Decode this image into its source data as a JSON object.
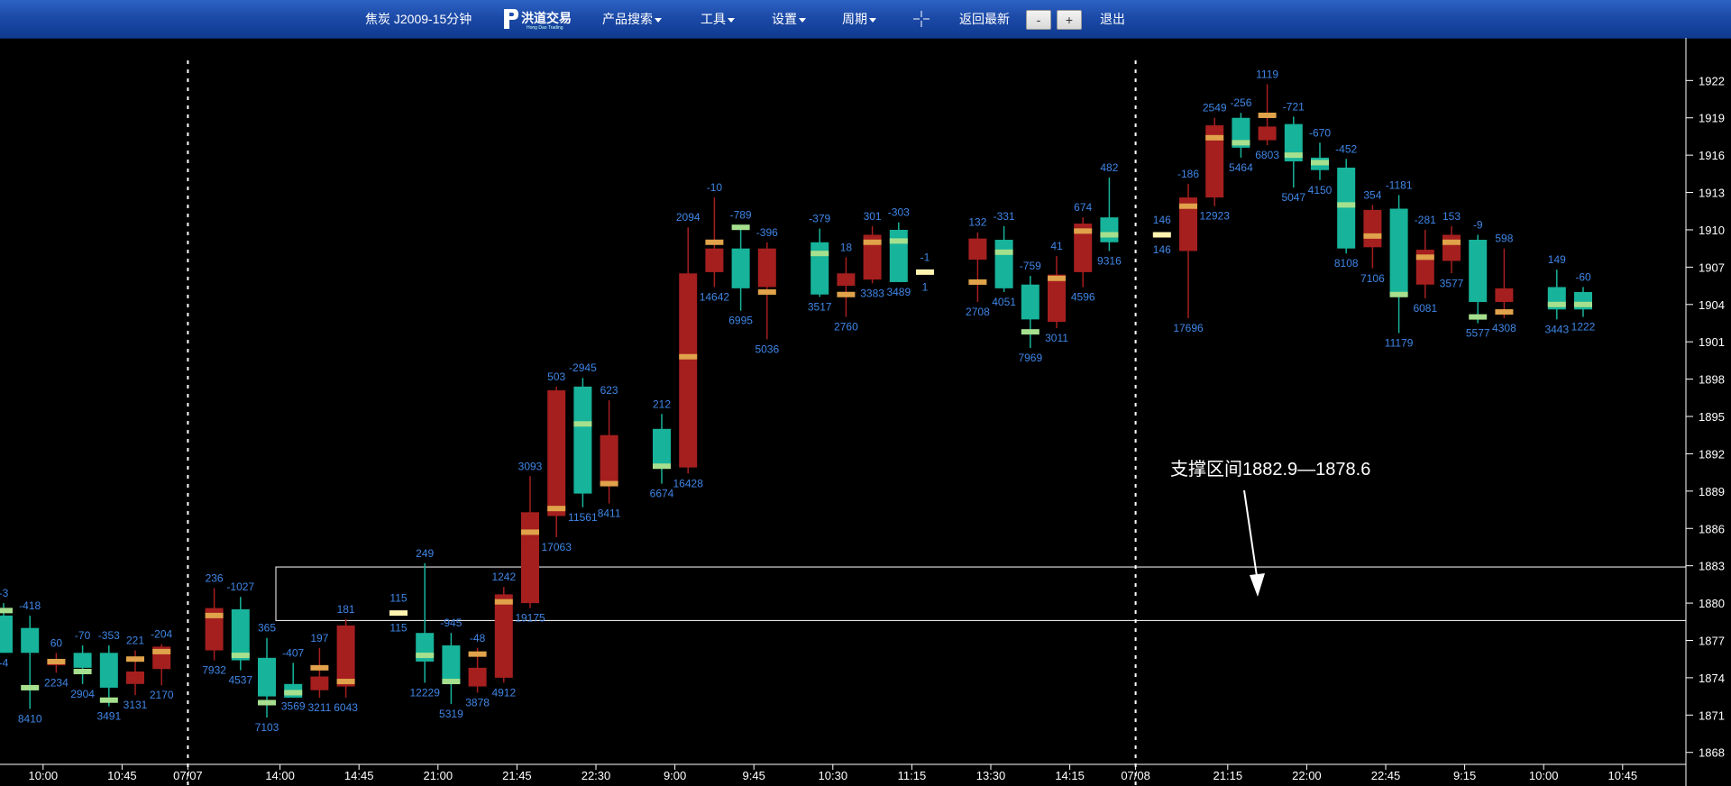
{
  "toolbar": {
    "symbol_title": "焦炭 J2009-15分钟",
    "logo_text": "洪道交易",
    "logo_subtext": "Hong Dao Trading",
    "menu_product_search": "产品搜索",
    "menu_tools": "工具",
    "menu_settings": "设置",
    "menu_period": "周期",
    "crosshair_icon": "crosshair-icon",
    "back_to_latest": "返回最新",
    "zoom_out": "-",
    "zoom_in": "+",
    "exit": "退出"
  },
  "annotation": {
    "text": "支撑区间1882.9—1878.6"
  },
  "colors": {
    "up": "#a51f1f",
    "down": "#17b39b",
    "vwap_up": "#e0a24a",
    "vwap_down": "#a6e08e",
    "label": "#3f86e6",
    "axis": "#ffffff"
  },
  "chart_data": {
    "type": "candlestick",
    "title": "焦炭 J2009-15分钟",
    "ylim": [
      1867.4,
      1923.4
    ],
    "y_ticks": [
      1868,
      1871,
      1874,
      1877,
      1880,
      1883,
      1886,
      1889,
      1892,
      1895,
      1898,
      1901,
      1904,
      1907,
      1910,
      1913,
      1916,
      1919,
      1922
    ],
    "x_ticks": [
      {
        "i": 1.5,
        "label": "10:00"
      },
      {
        "i": 4.5,
        "label": "10:45"
      },
      {
        "i": 7.0,
        "label": "07/07"
      },
      {
        "i": 10.5,
        "label": "14:00"
      },
      {
        "i": 13.5,
        "label": "14:45"
      },
      {
        "i": 16.5,
        "label": "21:00"
      },
      {
        "i": 19.5,
        "label": "21:45"
      },
      {
        "i": 22.5,
        "label": "22:30"
      },
      {
        "i": 25.5,
        "label": "9:00"
      },
      {
        "i": 28.5,
        "label": "9:45"
      },
      {
        "i": 31.5,
        "label": "10:30"
      },
      {
        "i": 34.5,
        "label": "11:15"
      },
      {
        "i": 37.5,
        "label": "13:30"
      },
      {
        "i": 40.5,
        "label": "14:15"
      },
      {
        "i": 43.0,
        "label": "07/08"
      },
      {
        "i": 46.5,
        "label": "21:15"
      },
      {
        "i": 49.5,
        "label": "22:00"
      },
      {
        "i": 52.5,
        "label": "22:45"
      },
      {
        "i": 55.5,
        "label": "9:15"
      },
      {
        "i": 58.5,
        "label": "10:00"
      },
      {
        "i": 61.5,
        "label": "10:45"
      }
    ],
    "session_dividers": [
      7.0,
      43.0
    ],
    "support_zone": [
      1878.6,
      1882.9
    ],
    "candles": [
      {
        "i": 0,
        "o": 1879,
        "h": 1880,
        "l": 1876,
        "c": 1876,
        "vw": 1879.4,
        "top": "-3",
        "bot": "-4"
      },
      {
        "i": 1,
        "o": 1878,
        "h": 1879,
        "l": 1871.5,
        "c": 1876,
        "vw": 1873.2,
        "top": "-418",
        "bot": "8410"
      },
      {
        "i": 2,
        "o": 1875,
        "h": 1876,
        "l": 1874.4,
        "c": 1875.5,
        "vw": 1875.3,
        "top": "60",
        "bot": "2234"
      },
      {
        "i": 3,
        "o": 1876,
        "h": 1876.6,
        "l": 1873.5,
        "c": 1874.8,
        "vw": 1874.5,
        "top": "-70",
        "bot": "2904"
      },
      {
        "i": 4,
        "o": 1876,
        "h": 1876.6,
        "l": 1871.7,
        "c": 1873.2,
        "vw": 1872.2,
        "top": "-353",
        "bot": "3491"
      },
      {
        "i": 5,
        "o": 1873.5,
        "h": 1876.2,
        "l": 1872.6,
        "c": 1874.5,
        "vw": 1875.5,
        "top": "221",
        "bot": "3131"
      },
      {
        "i": 6,
        "o": 1874.7,
        "h": 1876.7,
        "l": 1873.4,
        "c": 1876.5,
        "vw": 1876.1,
        "top": "-204",
        "bot": "2170"
      },
      {
        "i": 8,
        "o": 1876.2,
        "h": 1881.2,
        "l": 1875.4,
        "c": 1879.6,
        "vw": 1879.0,
        "top": "236",
        "bot": "7932"
      },
      {
        "i": 9,
        "o": 1879.5,
        "h": 1880.5,
        "l": 1874.6,
        "c": 1875.4,
        "vw": 1875.8,
        "top": "-1027",
        "bot": "4537"
      },
      {
        "i": 10,
        "o": 1875.6,
        "h": 1877.2,
        "l": 1870.8,
        "c": 1872.5,
        "vw": 1872.0,
        "top": "365",
        "bot": "7103"
      },
      {
        "i": 11,
        "o": 1873.5,
        "h": 1875.2,
        "l": 1872.5,
        "c": 1872.4,
        "vw": 1872.8,
        "top": "-407",
        "bot": "3569"
      },
      {
        "i": 12,
        "o": 1873.0,
        "h": 1876.4,
        "l": 1872.4,
        "c": 1874.1,
        "vw": 1874.8,
        "top": "197",
        "bot": "3211"
      },
      {
        "i": 13,
        "o": 1873.3,
        "h": 1878.7,
        "l": 1872.4,
        "c": 1878.2,
        "vw": 1873.7,
        "top": "181",
        "bot": "6043"
      },
      {
        "i": 15,
        "o": 1879.2,
        "h": 1879.6,
        "l": 1878.8,
        "c": 1879.2,
        "vw": 1879.2,
        "top": "115",
        "bot": "115",
        "doji": true
      },
      {
        "i": 16,
        "o": 1877.6,
        "h": 1883.2,
        "l": 1873.6,
        "c": 1875.3,
        "vw": 1875.8,
        "top": "249",
        "bot": "12229"
      },
      {
        "i": 17,
        "o": 1876.6,
        "h": 1877.6,
        "l": 1871.9,
        "c": 1873.5,
        "vw": 1873.7,
        "top": "-945",
        "bot": "5319"
      },
      {
        "i": 18,
        "o": 1873.3,
        "h": 1876.4,
        "l": 1872.8,
        "c": 1874.8,
        "vw": 1875.9,
        "top": "-48",
        "bot": "3878"
      },
      {
        "i": 19,
        "o": 1874.0,
        "h": 1881.3,
        "l": 1873.6,
        "c": 1880.7,
        "vw": 1880.1,
        "top": "1242",
        "bot": "4912"
      },
      {
        "i": 20,
        "o": 1880.0,
        "h": 1890.2,
        "l": 1879.6,
        "c": 1887.3,
        "vw": 1885.7,
        "top": "3093",
        "bot": "19175"
      },
      {
        "i": 21,
        "o": 1887.0,
        "h": 1897.4,
        "l": 1885.3,
        "c": 1897.1,
        "vw": 1887.6,
        "top": "503",
        "bot": "17063"
      },
      {
        "i": 22,
        "o": 1897.4,
        "h": 1898.1,
        "l": 1887.7,
        "c": 1888.8,
        "vw": 1894.4,
        "top": "-2945",
        "bot": "11561"
      },
      {
        "i": 23,
        "o": 1889.5,
        "h": 1896.3,
        "l": 1888.0,
        "c": 1893.5,
        "vw": 1889.6,
        "top": "623",
        "bot": "8411"
      },
      {
        "i": 25,
        "o": 1894.0,
        "h": 1895.2,
        "l": 1889.6,
        "c": 1890.9,
        "vw": 1891.0,
        "top": "212",
        "bot": "6674"
      },
      {
        "i": 26,
        "o": 1890.9,
        "h": 1910.2,
        "l": 1890.4,
        "c": 1906.5,
        "vw": 1899.8,
        "top": "2094",
        "bot": "16428"
      },
      {
        "i": 27,
        "o": 1906.6,
        "h": 1912.6,
        "l": 1905.4,
        "c": 1908.5,
        "vw": 1909.0,
        "top": "-10",
        "bot": "14642"
      },
      {
        "i": 28,
        "o": 1908.5,
        "h": 1910.4,
        "l": 1903.5,
        "c": 1905.3,
        "vw": 1910.2,
        "top": "-789",
        "bot": "6995"
      },
      {
        "i": 29,
        "o": 1905.4,
        "h": 1909.0,
        "l": 1901.2,
        "c": 1908.5,
        "vw": 1905.0,
        "top": "-396",
        "bot": "5036"
      },
      {
        "i": 31,
        "o": 1909.0,
        "h": 1910.1,
        "l": 1904.6,
        "c": 1904.8,
        "vw": 1908.1,
        "top": "-379",
        "bot": "3517"
      },
      {
        "i": 32,
        "o": 1905.5,
        "h": 1907.8,
        "l": 1903.0,
        "c": 1906.5,
        "vw": 1904.8,
        "top": "18",
        "bot": "2760"
      },
      {
        "i": 33,
        "o": 1906.0,
        "h": 1910.3,
        "l": 1905.7,
        "c": 1909.6,
        "vw": 1909.0,
        "top": "301",
        "bot": "3383"
      },
      {
        "i": 34,
        "o": 1910.0,
        "h": 1910.6,
        "l": 1905.8,
        "c": 1905.8,
        "vw": 1909.1,
        "top": "-303",
        "bot": "3489"
      },
      {
        "i": 35,
        "o": 1906.6,
        "h": 1907.0,
        "l": 1906.2,
        "c": 1906.6,
        "vw": 1906.6,
        "top": "-1",
        "bot": "1",
        "doji": true
      },
      {
        "i": 37,
        "o": 1907.6,
        "h": 1909.8,
        "l": 1904.2,
        "c": 1909.3,
        "vw": 1905.8,
        "top": "132",
        "bot": "2708"
      },
      {
        "i": 38,
        "o": 1909.2,
        "h": 1910.3,
        "l": 1905.0,
        "c": 1905.3,
        "vw": 1908.2,
        "top": "-331",
        "bot": "4051"
      },
      {
        "i": 39,
        "o": 1905.6,
        "h": 1906.3,
        "l": 1900.5,
        "c": 1902.8,
        "vw": 1901.8,
        "top": "-759",
        "bot": "7969"
      },
      {
        "i": 40,
        "o": 1902.6,
        "h": 1907.9,
        "l": 1902.1,
        "c": 1906.4,
        "vw": 1906.1,
        "top": "41",
        "bot": "3011"
      },
      {
        "i": 41,
        "o": 1906.6,
        "h": 1911.0,
        "l": 1905.4,
        "c": 1910.5,
        "vw": 1909.9,
        "top": "674",
        "bot": "4596"
      },
      {
        "i": 42,
        "o": 1911.0,
        "h": 1914.2,
        "l": 1908.3,
        "c": 1909.0,
        "vw": 1909.6,
        "top": "482",
        "bot": "9316"
      },
      {
        "i": 44,
        "o": 1909.6,
        "h": 1910.0,
        "l": 1909.2,
        "c": 1909.6,
        "vw": 1909.6,
        "top": "146",
        "bot": "146",
        "doji": true
      },
      {
        "i": 45,
        "o": 1908.3,
        "h": 1913.7,
        "l": 1902.9,
        "c": 1912.6,
        "vw": 1911.9,
        "top": "-186",
        "bot": "17696"
      },
      {
        "i": 46,
        "o": 1912.6,
        "h": 1919.0,
        "l": 1911.9,
        "c": 1918.4,
        "vw": 1917.4,
        "top": "2549",
        "bot": "12923"
      },
      {
        "i": 47,
        "o": 1919.0,
        "h": 1919.4,
        "l": 1915.8,
        "c": 1916.6,
        "vw": 1917.0,
        "top": "-256",
        "bot": "5464"
      },
      {
        "i": 48,
        "o": 1917.2,
        "h": 1921.7,
        "l": 1916.8,
        "c": 1918.3,
        "vw": 1919.2,
        "top": "1119",
        "bot": "6803"
      },
      {
        "i": 49,
        "o": 1918.5,
        "h": 1919.1,
        "l": 1913.4,
        "c": 1915.5,
        "vw": 1916.0,
        "top": "-721",
        "bot": "5047"
      },
      {
        "i": 50,
        "o": 1915.8,
        "h": 1917.0,
        "l": 1914.0,
        "c": 1914.8,
        "vw": 1915.4,
        "top": "-670",
        "bot": "4150"
      },
      {
        "i": 51,
        "o": 1915.0,
        "h": 1915.7,
        "l": 1908.1,
        "c": 1908.5,
        "vw": 1912.0,
        "top": "-452",
        "bot": "8108"
      },
      {
        "i": 52,
        "o": 1908.6,
        "h": 1912.0,
        "l": 1906.9,
        "c": 1911.6,
        "vw": 1909.5,
        "top": "354",
        "bot": "7106"
      },
      {
        "i": 53,
        "o": 1911.7,
        "h": 1912.8,
        "l": 1901.7,
        "c": 1904.6,
        "vw": 1904.8,
        "top": "-1181",
        "bot": "11179"
      },
      {
        "i": 54,
        "o": 1905.6,
        "h": 1910.0,
        "l": 1904.5,
        "c": 1908.4,
        "vw": 1907.8,
        "top": "-281",
        "bot": "6081"
      },
      {
        "i": 55,
        "o": 1907.5,
        "h": 1910.3,
        "l": 1906.5,
        "c": 1909.6,
        "vw": 1909.0,
        "top": "153",
        "bot": "3577"
      },
      {
        "i": 56,
        "o": 1909.2,
        "h": 1909.6,
        "l": 1902.5,
        "c": 1904.2,
        "vw": 1903.0,
        "top": "-9",
        "bot": "5577"
      },
      {
        "i": 57,
        "o": 1904.2,
        "h": 1908.5,
        "l": 1902.9,
        "c": 1905.3,
        "vw": 1903.4,
        "top": "598",
        "bot": "4308"
      },
      {
        "i": 59,
        "o": 1905.4,
        "h": 1906.8,
        "l": 1902.8,
        "c": 1903.6,
        "vw": 1904.0,
        "top": "149",
        "bot": "3443"
      },
      {
        "i": 60,
        "o": 1905.0,
        "h": 1905.4,
        "l": 1903.0,
        "c": 1903.6,
        "vw": 1904.0,
        "top": "-60",
        "bot": "1222"
      }
    ]
  }
}
